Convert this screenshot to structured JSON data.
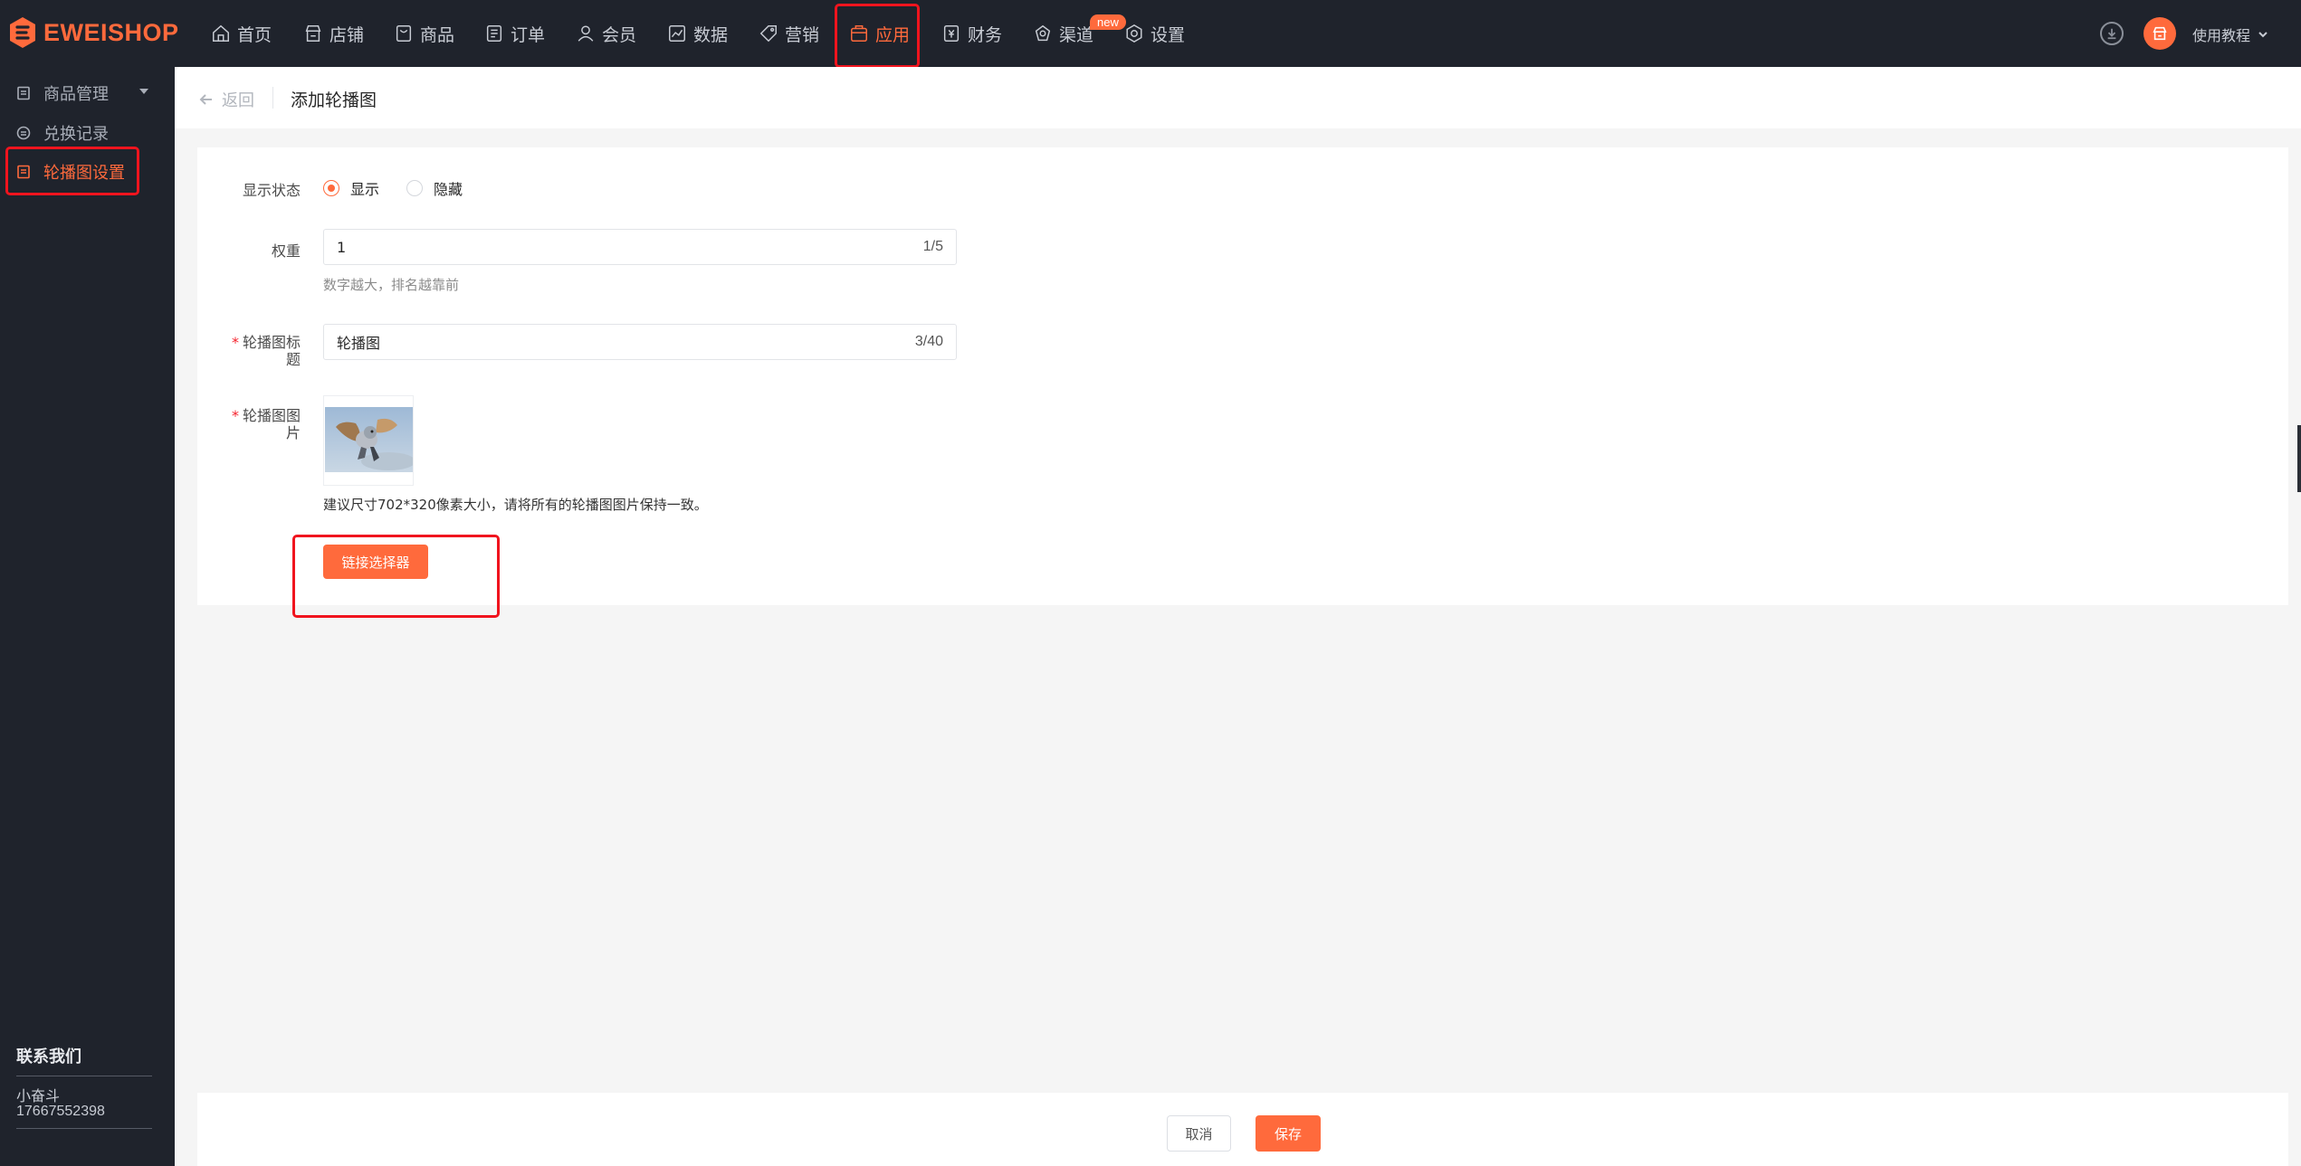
{
  "brand": {
    "name": "EWEISHOP",
    "accent": "#ff6a3c",
    "dark": "#1f232c"
  },
  "topnav": {
    "items": [
      {
        "label": "首页",
        "icon": "home-icon"
      },
      {
        "label": "店铺",
        "icon": "store-icon"
      },
      {
        "label": "商品",
        "icon": "goods-icon"
      },
      {
        "label": "订单",
        "icon": "order-icon"
      },
      {
        "label": "会员",
        "icon": "member-icon"
      },
      {
        "label": "数据",
        "icon": "chart-icon"
      },
      {
        "label": "营销",
        "icon": "tag-icon"
      },
      {
        "label": "应用",
        "icon": "app-icon",
        "active": true
      },
      {
        "label": "财务",
        "icon": "finance-icon"
      },
      {
        "label": "渠道",
        "icon": "channel-icon"
      },
      {
        "label": "设置",
        "icon": "gear-icon"
      }
    ],
    "new_badge": "new",
    "help_label": "使用教程"
  },
  "sidebar": {
    "items": [
      {
        "label": "商品管理",
        "icon": "doc-icon"
      },
      {
        "label": "兑换记录",
        "icon": "record-icon"
      },
      {
        "label": "轮播图设置",
        "icon": "doc-icon",
        "active": true
      }
    ],
    "contact": {
      "title": "联系我们",
      "name": "小奋斗",
      "phone": "17667552398"
    }
  },
  "header": {
    "back_label": "返回",
    "title": "添加轮播图"
  },
  "form": {
    "status": {
      "label": "显示状态",
      "options": [
        {
          "label": "显示",
          "checked": true
        },
        {
          "label": "隐藏",
          "checked": false
        }
      ]
    },
    "weight": {
      "label": "权重",
      "value": "1",
      "count": "1/5",
      "help": "数字越大，排名越靠前"
    },
    "title": {
      "label": "轮播图标题",
      "value": "轮播图",
      "count": "3/40"
    },
    "image": {
      "label": "轮播图图片",
      "help": "建议尺寸702*320像素大小，请将所有的轮播图图片保持一致。"
    },
    "link_button": "链接选择器"
  },
  "footer": {
    "cancel_label": "取消",
    "save_label": "保存"
  }
}
